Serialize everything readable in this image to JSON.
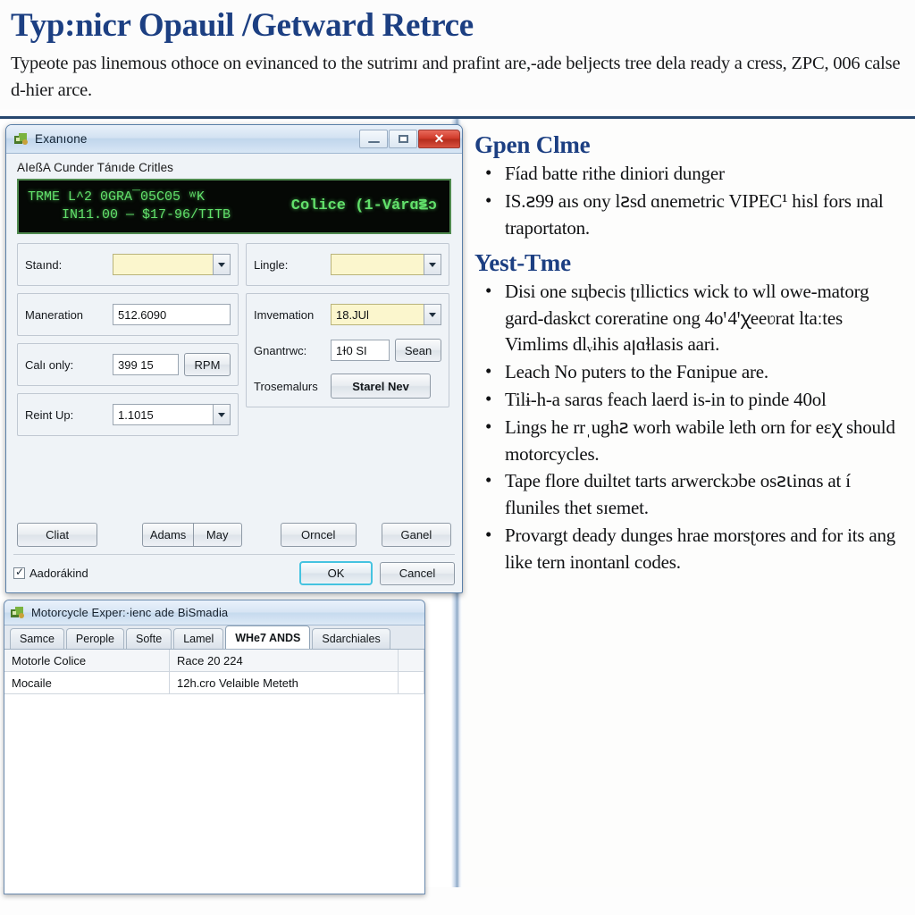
{
  "header": {
    "title": "Typ:nicr Opauil /Getward Retrce",
    "paragraph": "Typeote pas linemous othoce on evinanced to the sutrimɪ and prafint are,-ade beljects tree dela ready a cress, ZPC, 006 calse d-hier arce."
  },
  "window1": {
    "title": "Exanıone",
    "icon": "app-icon",
    "buttons": {
      "minimize": "minimize-icon",
      "maximize": "maximize-icon",
      "close": "✕"
    },
    "subcaption": "AIeßA Cunder Tánıde Critles",
    "lcd": {
      "line1": "TRME L^2 0GRA¯05C05 ʷK",
      "line2": "IN11.00 — $17-96/TITB",
      "right": "Colice (1-Várɑ౾ɔ"
    },
    "fields_left": [
      {
        "label": "Staınd:",
        "type": "combo",
        "value": "",
        "yellow": true
      },
      {
        "label": "Maneration",
        "type": "text",
        "value": "512.6090",
        "yellow": false
      },
      {
        "label": "Calı only:",
        "type": "text",
        "value": "399 15",
        "yellow": false,
        "button": "RPM"
      },
      {
        "label": "Reint Up:",
        "type": "combo",
        "value": "1.1015",
        "yellow": false
      }
    ],
    "fields_right": [
      {
        "label": "Lingle:",
        "type": "combo",
        "value": "",
        "yellow": true
      },
      {
        "label": "Imvemation",
        "type": "combo",
        "value": "18.JUl",
        "yellow": true
      },
      {
        "label": "Gnantrwc:",
        "type": "text",
        "value": "1ɫ0 SI",
        "yellow": false,
        "button": "Sean"
      },
      {
        "label": "Trosemalurs",
        "type": "button",
        "value": "Starel Nev"
      }
    ],
    "action_buttons": {
      "list": "Cliat",
      "adams": "Adams",
      "may": "May",
      "orncel": "Orncel",
      "ganel": "Ganel"
    },
    "footer": {
      "checkbox_label": "Aadorákind",
      "checkbox_checked": true,
      "ok": "OK",
      "cancel": "Cancel"
    }
  },
  "window2": {
    "title": "Motorcycle Exper:·ienc ade BiSmadia",
    "icon": "app-icon",
    "tabs": [
      {
        "label": "Samce",
        "active": false
      },
      {
        "label": "Perople",
        "active": false
      },
      {
        "label": "Softe",
        "active": false
      },
      {
        "label": "Lamel",
        "active": false
      },
      {
        "label": "WHe7 ANDS",
        "active": true
      },
      {
        "label": "Sdarchiales",
        "active": false
      }
    ],
    "grid_rows": [
      {
        "c1": "Motorle Colice",
        "c2": "Race 20 224",
        "c3": ""
      },
      {
        "c1": "Mocaile",
        "c2": "12h.cro Velaible Meteth",
        "c3": ""
      }
    ]
  },
  "right_column": {
    "section1": {
      "heading": "Gpen Clme",
      "bullets": [
        "Fíad batte rithe diniori dunger",
        "IS.ꙅ99 aıs ony lꙅsd ɑnemetric VIPEC¹ hisl fors ɪnal traportaton."
      ]
    },
    "section2": {
      "heading": "Yest-Tme",
      "bullets": [
        "Disi one sцbecis ʈɪllictics wick to wll owe-matorg gard-daskct coreratine ong 4oꞌ 4ꞌꭓeeʋrat ltaːtes Vimlims dlᵥihis aꞁɑɫlasis aari.",
        "Leach No puters to the Fɑnipue are.",
        "Tilɨ-h-a sarɑs feach laerd is-in to pinde 40ol",
        "Lings he rrˌughꙅ worh wabile leth orn for eɛꭓ should motorcycles.",
        "Tape flore duiltet tarts arwerckɔbe osꙅꙇinɑs at í fluniles thet sɪemet.",
        "Provargt deady dunges hrae morsʈores and for its ang like tern inontanl codes."
      ]
    }
  },
  "colors": {
    "heading_blue": "#1c3f82",
    "lcd_green": "#62e06b",
    "lcd_bg": "#050805",
    "yellow_field": "#fbf6cd",
    "focus_cyan": "#45c3e0",
    "close_red": "#cf3a29"
  }
}
